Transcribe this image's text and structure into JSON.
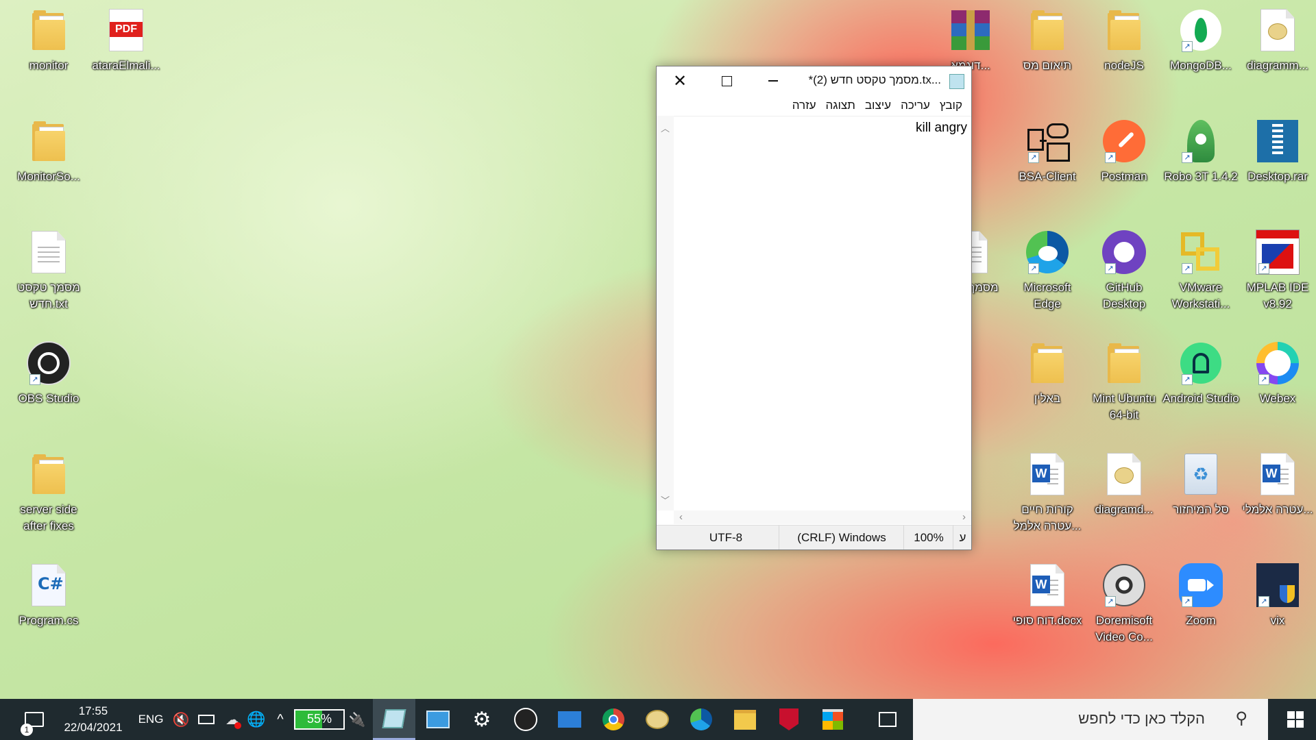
{
  "desktop": {
    "left_icons": [
      {
        "label": "monitor"
      },
      {
        "label": "ataraElmali..."
      },
      {
        "label": "MonitorSo..."
      },
      {
        "label": "מסמך טקסט חדש.txt"
      },
      {
        "label": "OBS Studio"
      },
      {
        "label": "server side after fixes"
      },
      {
        "label": "Program.cs"
      }
    ],
    "right_icons": [
      {
        "label": "דוגמא..."
      },
      {
        "label": "תיאום מס"
      },
      {
        "label": "nodeJS"
      },
      {
        "label": "MongoDB..."
      },
      {
        "label": "diagramm..."
      },
      {
        "label": "BSA-Client"
      },
      {
        "label": "Postman"
      },
      {
        "label": "Robo 3T 1.4.2"
      },
      {
        "label": "Desktop.rar"
      },
      {
        "label": "מסמך חדש"
      },
      {
        "label": "Microsoft Edge"
      },
      {
        "label": "GitHub Desktop"
      },
      {
        "label": "VMware Workstati..."
      },
      {
        "label": "MPLAB IDE v8.92"
      },
      {
        "label": "באלין"
      },
      {
        "label": "Mint Ubuntu 64-bit"
      },
      {
        "label": "Android Studio"
      },
      {
        "label": "Webex"
      },
      {
        "label": "קורות חיים עטרה אלמל..."
      },
      {
        "label": "diagramd..."
      },
      {
        "label": "סל המיחזור"
      },
      {
        "label": "עטרה אלמלי..."
      },
      {
        "label": "דוח סופי.docx"
      },
      {
        "label": "Doremisoft Video Co..."
      },
      {
        "label": "Zoom"
      },
      {
        "label": "vix"
      }
    ]
  },
  "notepad": {
    "title": "*מסמך טקסט חדש (2).tx...",
    "menu": [
      "קובץ",
      "עריכה",
      "עיצוב",
      "תצוגה",
      "עזרה"
    ],
    "content": "kill angry",
    "status": {
      "zoom": "100%",
      "line_ending": "(CRLF) Windows",
      "encoding": "UTF-8",
      "direction": "ע"
    }
  },
  "taskbar": {
    "search_placeholder": "הקלד כאן כדי לחפש",
    "time": "17:55",
    "date": "22/04/2021",
    "language": "ENG",
    "battery_percent": "55%",
    "notification_count": "1"
  }
}
